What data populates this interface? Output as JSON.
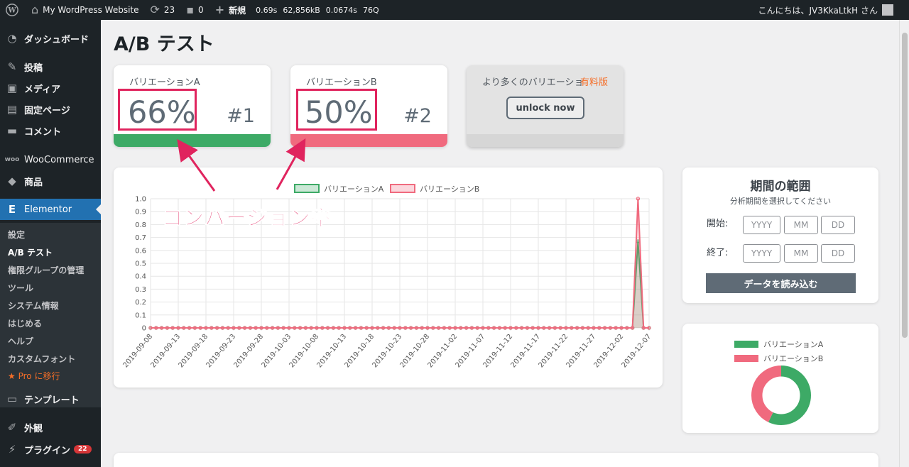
{
  "adminbar": {
    "site_name": "My WordPress Website",
    "updates": "23",
    "comments": "0",
    "new_label": "新規",
    "stats": [
      "0.69s",
      "62,856kB",
      "0.0674s",
      "76Q"
    ],
    "greeting": "こんにちは、JV3KkaLtkH さん"
  },
  "sidebar": {
    "items": [
      {
        "label": "ダッシュボード",
        "icon": "dashboard-icon"
      },
      {
        "label": "投稿",
        "icon": "pin-icon"
      },
      {
        "label": "メディア",
        "icon": "media-icon"
      },
      {
        "label": "固定ページ",
        "icon": "page-icon"
      },
      {
        "label": "コメント",
        "icon": "comment-icon"
      },
      {
        "label": "WooCommerce",
        "icon": "woo-icon"
      },
      {
        "label": "商品",
        "icon": "box-icon"
      },
      {
        "label": "Elementor",
        "icon": "elementor-icon"
      },
      {
        "label": "テンプレート",
        "icon": "folder-icon"
      },
      {
        "label": "外観",
        "icon": "brush-icon"
      },
      {
        "label": "プラグイン",
        "icon": "plugin-icon"
      }
    ],
    "plugin_badge": "22",
    "submenu": [
      "設定",
      "A/B テスト",
      "権限グループの管理",
      "ツール",
      "システム情報",
      "はじめる",
      "ヘルプ",
      "カスタムフォント"
    ],
    "pro_label": "Pro に移行"
  },
  "page_title": "A/B テスト",
  "variations": [
    {
      "label": "バリエーションA",
      "value": "66%",
      "rank": "#1",
      "color": "#3daa66"
    },
    {
      "label": "バリエーションB",
      "value": "50%",
      "rank": "#2",
      "color": "#f06a7e"
    }
  ],
  "locked": {
    "text": "より多くのバリエーショ",
    "badge": "有料版",
    "button": "unlock now"
  },
  "annotation": "コンバージョン率",
  "chart_data": {
    "type": "line",
    "series": [
      {
        "name": "バリエーションA",
        "color": "#3daa66",
        "peak": 0.67
      },
      {
        "name": "バリエーションB",
        "color": "#f06a7e",
        "peak": 1.0
      }
    ],
    "x_start": "2019-09-08",
    "x_end": "2019-12-07",
    "x_tick_labels": [
      "2019-09-08",
      "2019-09-13",
      "2019-09-18",
      "2019-09-23",
      "2019-09-28",
      "2019-10-03",
      "2019-10-08",
      "2019-10-13",
      "2019-10-18",
      "2019-10-23",
      "2019-10-28",
      "2019-11-02",
      "2019-11-07",
      "2019-11-12",
      "2019-11-17",
      "2019-11-22",
      "2019-11-27",
      "2019-12-02",
      "2019-12-07"
    ],
    "peak_date": "2019-12-05",
    "y_ticks": [
      "0",
      "0.1",
      "0.2",
      "0.3",
      "0.4",
      "0.5",
      "0.6",
      "0.7",
      "0.8",
      "0.9",
      "1.0"
    ],
    "ylim": [
      0,
      1.0
    ],
    "legend_position": "top"
  },
  "date_range": {
    "title": "期間の範囲",
    "subtitle": "分析期間を選択してください",
    "start_label": "開始:",
    "end_label": "終了:",
    "placeholders": [
      "YYYY",
      "MM",
      "DD"
    ],
    "load_button": "データを読み込む"
  },
  "pie": {
    "legend": [
      {
        "label": "バリエーションA",
        "color": "#3daa66"
      },
      {
        "label": "バリエーションB",
        "color": "#f06a7e"
      }
    ],
    "values": [
      0.57,
      0.43
    ]
  }
}
